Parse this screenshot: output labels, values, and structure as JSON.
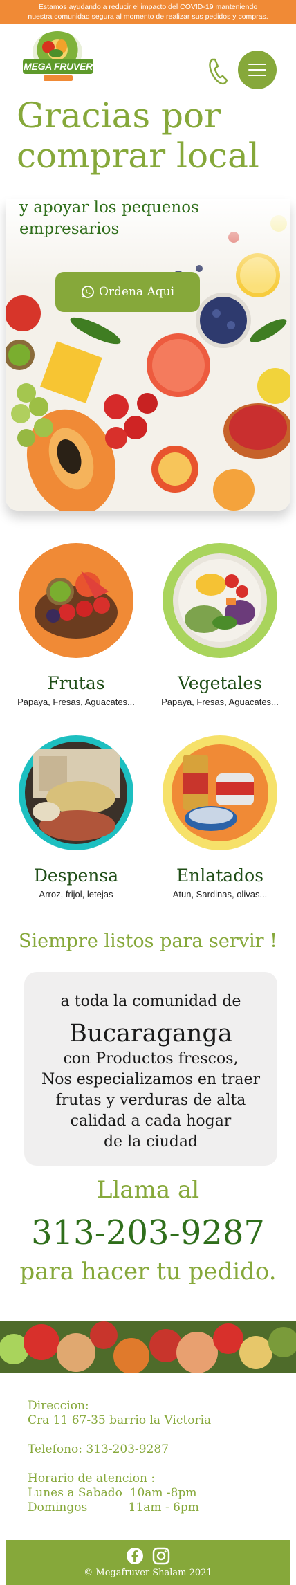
{
  "notice": {
    "line1": "Estamos ayudando a reducir el impacto del COVID-19  manteniendo",
    "line2": "nuestra comunidad segura al momento de realizar sus pedidos y compras."
  },
  "header": {
    "logo_text": "MEGA FRUVER",
    "icons": {
      "phone": "phone-icon",
      "menu": "hamburger-menu-icon"
    }
  },
  "hero": {
    "title_line1": "Gracias por",
    "title_line2": "comprar local",
    "subtitle_line1": "y apoyar los pequenos",
    "subtitle_line2": "empresarios",
    "order_button": "Ordena Aqui"
  },
  "categories": [
    {
      "title": "Frutas",
      "desc": "Papaya, Fresas, Aguacates..."
    },
    {
      "title": "Vegetales",
      "desc": "Papaya, Fresas, Aguacates..."
    },
    {
      "title": "Despensa",
      "desc": "Arroz, frijol, letejas"
    },
    {
      "title": "Enlatados",
      "desc": "Atun, Sardinas, olivas..."
    }
  ],
  "ready_heading": "Siempre listos para servir !",
  "card": {
    "line1": "a toda la comunidad de",
    "city": "Bucaraganga",
    "body": [
      "con  Productos frescos,",
      "Nos especializamos en traer",
      "frutas y verduras de alta",
      "calidad a cada hogar",
      "de la ciudad"
    ]
  },
  "call": {
    "line1": "Llama al",
    "number": "313-203-9287",
    "line2": "para hacer tu pedido."
  },
  "contact": {
    "address_label": "Direccion:",
    "address": "Cra 11 67-35 barrio la Victoria",
    "phone": "Telefono: 313-203-9287",
    "hours_label": "Horario de atencion :",
    "hours_weekday": "Lunes a Sabado  10am -8pm",
    "hours_sunday": "Domingos           11am - 6pm"
  },
  "footer": {
    "copyright": "© Megafruver Shalam 2021",
    "icons": [
      "facebook-icon",
      "instagram-icon"
    ]
  },
  "colors": {
    "brand_green": "#86a83a",
    "dark_green": "#2f6e1b",
    "orange": "#f08a36"
  }
}
